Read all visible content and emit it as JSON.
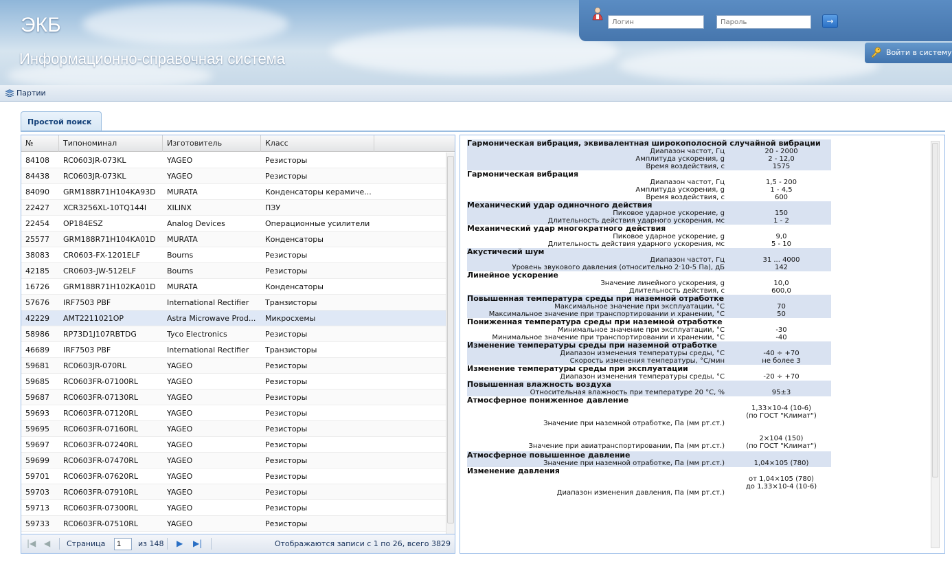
{
  "header": {
    "title": "ЭКБ",
    "subtitle": "Информационно-справочная система",
    "login_placeholder": "Логин",
    "password_placeholder": "Пароль",
    "go_label": "→",
    "enter_label": "Войти в систему"
  },
  "menu": {
    "parties": "Партии"
  },
  "tabs": {
    "simple_search": "Простой поиск"
  },
  "grid": {
    "columns": [
      "№",
      "Типономинал",
      "Изготовитель",
      "Класс"
    ],
    "rows": [
      [
        "84108",
        "RC0603JR-073KL",
        "YAGEO",
        "Резисторы"
      ],
      [
        "84438",
        "RC0603JR-073KL",
        "YAGEO",
        "Резисторы"
      ],
      [
        "84090",
        "GRM188R71H104KA93D",
        "MURATA",
        "Конденсаторы керамиче..."
      ],
      [
        "22427",
        "XCR3256XL-10TQ144I",
        "XILINX",
        "ПЗУ"
      ],
      [
        "22454",
        "OP184ESZ",
        "Analog Devices",
        "Операционные усилители"
      ],
      [
        "25577",
        "GRM188R71H104KA01D",
        "MURATA",
        "Конденсаторы"
      ],
      [
        "38083",
        "CR0603-FX-1201ELF",
        "Bourns",
        "Резисторы"
      ],
      [
        "42185",
        "CR0603-JW-512ELF",
        "Bourns",
        "Резисторы"
      ],
      [
        "16726",
        "GRM188R71H102KA01D",
        "MURATA",
        "Конденсаторы"
      ],
      [
        "57676",
        "IRF7503 PBF",
        "International Rectifier",
        "Транзисторы"
      ],
      [
        "42229",
        "AMT2211021OP",
        "Astra Microwave Prod...",
        "Микросхемы"
      ],
      [
        "58986",
        "RP73D1J107RBTDG",
        "Tyco Electronics",
        "Резисторы"
      ],
      [
        "46689",
        "IRF7503 PBF",
        "International Rectifier",
        "Транзисторы"
      ],
      [
        "59681",
        "RC0603JR-070RL",
        "YAGEO",
        "Резисторы"
      ],
      [
        "59685",
        "RC0603FR-07100RL",
        "YAGEO",
        "Резисторы"
      ],
      [
        "59687",
        "RC0603FR-07130RL",
        "YAGEO",
        "Резисторы"
      ],
      [
        "59693",
        "RC0603FR-07120RL",
        "YAGEO",
        "Резисторы"
      ],
      [
        "59695",
        "RC0603FR-07160RL",
        "YAGEO",
        "Резисторы"
      ],
      [
        "59697",
        "RC0603FR-07240RL",
        "YAGEO",
        "Резисторы"
      ],
      [
        "59699",
        "RC0603FR-07470RL",
        "YAGEO",
        "Резисторы"
      ],
      [
        "59701",
        "RC0603FR-07620RL",
        "YAGEO",
        "Резисторы"
      ],
      [
        "59703",
        "RC0603FR-07910RL",
        "YAGEO",
        "Резисторы"
      ],
      [
        "59713",
        "RC0603FR-07300RL",
        "YAGEO",
        "Резисторы"
      ],
      [
        "59733",
        "RC0603FR-07510RL",
        "YAGEO",
        "Резисторы"
      ]
    ],
    "selected_index": 10
  },
  "pager": {
    "page_label": "Страница",
    "page_value": "1",
    "of_label": "из 148",
    "summary": "Отображаются записи с 1 по 26, всего 3829"
  },
  "specs": [
    {
      "type": "section",
      "text": "Гармоническая вибрация, эквивалентная широкополосной случайной вибрации",
      "shade": true
    },
    {
      "type": "row",
      "k": "Диапазон частот, Гц",
      "v": "20 - 2000",
      "shade": true
    },
    {
      "type": "row",
      "k": "Амплитуда ускорения, g",
      "v": "2 - 12,0",
      "shade": true
    },
    {
      "type": "row",
      "k": "Время воздействия, с",
      "v": "1575",
      "shade": true
    },
    {
      "type": "section",
      "text": "Гармоническая вибрация",
      "shade": false
    },
    {
      "type": "row",
      "k": "Диапазон частот, Гц",
      "v": "1,5 - 200",
      "shade": false
    },
    {
      "type": "row",
      "k": "Амплитуда ускорения, g",
      "v": "1 - 4,5",
      "shade": false
    },
    {
      "type": "row",
      "k": "Время воздействия, с",
      "v": "600",
      "shade": false
    },
    {
      "type": "section",
      "text": "Механический удар одиночного действия",
      "shade": true
    },
    {
      "type": "row",
      "k": "Пиковое ударное ускорение, g",
      "v": "150",
      "shade": true
    },
    {
      "type": "row",
      "k": "Длительность действия ударного ускорения, мс",
      "v": "1 - 2",
      "shade": true
    },
    {
      "type": "section",
      "text": "Механический удар многократного действия",
      "shade": false
    },
    {
      "type": "row",
      "k": "Пиковое ударное ускорение, g",
      "v": "9,0",
      "shade": false
    },
    {
      "type": "row",
      "k": "Длительность действия ударного ускорения, мс",
      "v": "5 - 10",
      "shade": false
    },
    {
      "type": "section",
      "text": "Акустичесий шум",
      "shade": true
    },
    {
      "type": "row",
      "k": "Диапазон частот, Гц",
      "v": "31 ... 4000",
      "shade": true
    },
    {
      "type": "row",
      "k": "Уровень звукового давления (относительно 2·10-5 Па), дБ",
      "v": "142",
      "shade": true
    },
    {
      "type": "section",
      "text": "Линейное ускорение",
      "shade": false
    },
    {
      "type": "row",
      "k": "Значение линейного ускорения, g",
      "v": "10,0",
      "shade": false
    },
    {
      "type": "row",
      "k": "Длительность действия, с",
      "v": "600,0",
      "shade": false
    },
    {
      "type": "section",
      "text": "Повышенная температура среды при наземной отработке",
      "shade": true
    },
    {
      "type": "row",
      "k": "Максимальное значение при эксплуатации, °С",
      "v": "70",
      "shade": true
    },
    {
      "type": "row",
      "k": "Максимальное значение при транспортировании и хранении, °С",
      "v": "50",
      "shade": true
    },
    {
      "type": "section",
      "text": "Пониженная температура среды при наземной отработке",
      "shade": false
    },
    {
      "type": "row",
      "k": "Минимальное значение при эксплуатации, °С",
      "v": "-30",
      "shade": false
    },
    {
      "type": "row",
      "k": "Минимальное значение при транспортировании и хранении, °С",
      "v": "-40",
      "shade": false
    },
    {
      "type": "section",
      "text": "Изменение температуры среды при наземной отработке",
      "shade": true
    },
    {
      "type": "row",
      "k": "Диапазон изменения температуры среды, °С",
      "v": "-40 ÷ +70",
      "shade": true
    },
    {
      "type": "row",
      "k": "Скорость изменения температуры, °С/мин",
      "v": "не более 3",
      "shade": true
    },
    {
      "type": "section",
      "text": "Изменение температуры среды при эксплуатации",
      "shade": false
    },
    {
      "type": "row",
      "k": "Диапазон изменения температуры среды, °С",
      "v": "-20 ÷ +70",
      "shade": false
    },
    {
      "type": "section",
      "text": "Повышенная влажность воздуха",
      "shade": true
    },
    {
      "type": "row",
      "k": "Относительная влажность при температуре 20 °С, %",
      "v": "95±3",
      "shade": true
    },
    {
      "type": "section",
      "text": "Атмосферное пониженное давление",
      "shade": false
    },
    {
      "type": "tall",
      "k": "Значение при наземной отработке, Па (мм рт.ст.)",
      "v": "1,33×10-4 (10-6)\n(по ГОСТ \"Климат\")",
      "shade": false
    },
    {
      "type": "tall2",
      "k": "Значение при авиатранспортировании, Па (мм рт.ст.)",
      "v": "2×104 (150)\n(по ГОСТ \"Климат\")",
      "shade": false
    },
    {
      "type": "section",
      "text": "Атмосферное повышенное давление",
      "shade": true
    },
    {
      "type": "row",
      "k": "Значение при наземной отработке, Па (мм рт.ст.)",
      "v": "1,04×105 (780)",
      "shade": true
    },
    {
      "type": "section",
      "text": "Изменение давления",
      "shade": false
    },
    {
      "type": "tall3",
      "k": "Диапазон изменения давления, Па (мм рт.ст.)",
      "v": "от 1,04×105 (780)\nдо 1,33×10-4 (10-6)",
      "shade": false
    }
  ],
  "colors": {
    "header_blue": "#4676ad",
    "selected_row": "#dfe8f6",
    "section_shade": "#d9e2f1",
    "border": "#99bbe8"
  }
}
